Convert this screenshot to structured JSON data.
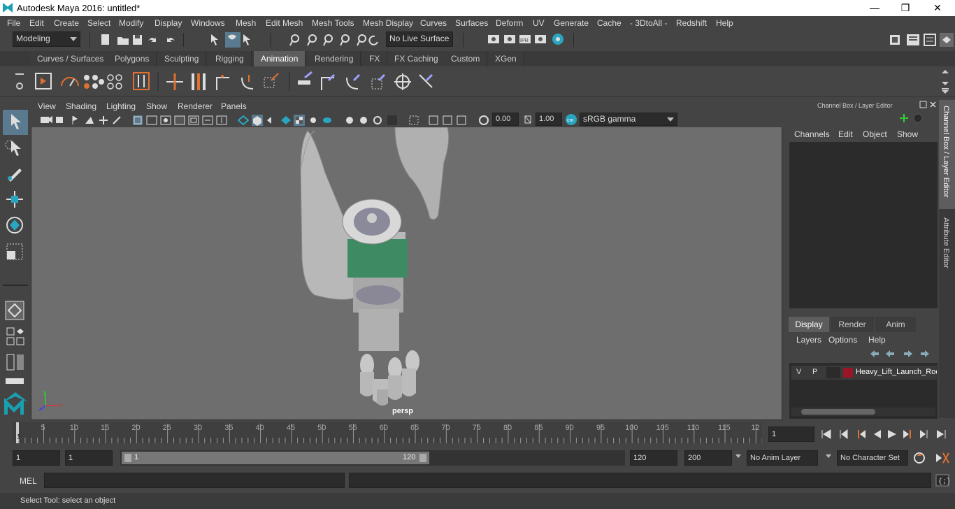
{
  "window": {
    "title": "Autodesk Maya 2016: untitled*",
    "minimize": "—",
    "maximize": "❐",
    "close": "✕"
  },
  "menubar": [
    "File",
    "Edit",
    "Create",
    "Select",
    "Modify",
    "Display",
    "Windows",
    "Mesh",
    "Edit Mesh",
    "Mesh Tools",
    "Mesh Display",
    "Curves",
    "Surfaces",
    "Deform",
    "UV",
    "Generate",
    "Cache",
    "- 3DtoAll -",
    "Redshift",
    "Help"
  ],
  "statusline": {
    "mode": "Modeling",
    "live_surface": "No Live Surface"
  },
  "shelf_tabs": [
    "Curves / Surfaces",
    "Polygons",
    "Sculpting",
    "Rigging",
    "Animation",
    "Rendering",
    "FX",
    "FX Caching",
    "Custom",
    "XGen"
  ],
  "active_shelf_tab": "Animation",
  "panel_menu": [
    "View",
    "Shading",
    "Lighting",
    "Show",
    "Renderer",
    "Panels"
  ],
  "panel_tools": {
    "exposure": "0.00",
    "gamma": "1.00",
    "color_space": "sRGB gamma"
  },
  "viewport": {
    "camera_label": "persp",
    "axis_x": "x",
    "axis_y": "y",
    "axis_z": "z"
  },
  "channel_box": {
    "title": "Channel Box / Layer Editor",
    "menu": [
      "Channels",
      "Edit",
      "Object",
      "Show"
    ]
  },
  "layer_editor": {
    "tabs": [
      "Display",
      "Render",
      "Anim"
    ],
    "active_tab": "Display",
    "menu": [
      "Layers",
      "Options",
      "Help"
    ],
    "layer": {
      "visible": "V",
      "playback": "P",
      "name": "Heavy_Lift_Launch_Rocket",
      "color": "#9b1528"
    }
  },
  "side_tabs": [
    "Channel Box / Layer Editor",
    "Attribute Editor"
  ],
  "timeline": {
    "ticks": [
      "5",
      "10",
      "15",
      "20",
      "25",
      "30",
      "35",
      "40",
      "45",
      "50",
      "55",
      "60",
      "65",
      "70",
      "75",
      "80",
      "85",
      "90",
      "95",
      "100",
      "105",
      "110",
      "115",
      "12"
    ],
    "first_frame": "1",
    "current_frame": "1"
  },
  "range": {
    "start": "1",
    "playback_start": "1",
    "slider_start": "1",
    "slider_end": "120",
    "playback_end": "120",
    "end": "200",
    "anim_layer": "No Anim Layer",
    "character_set": "No Character Set"
  },
  "command_line": {
    "label": "MEL"
  },
  "help_line": "Select Tool: select an object",
  "colors": {
    "bg": "#444444",
    "viewport_bg": "#6e6e6e",
    "accent": "#5d5d5d",
    "maya_teal": "#1a9fb0"
  }
}
